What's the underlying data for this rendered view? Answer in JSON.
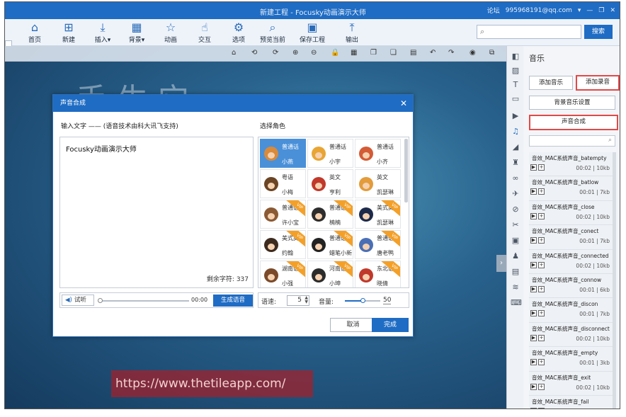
{
  "window": {
    "title": "新建工程 - Focusky动画演示大师",
    "forum": "论坛",
    "account": "995968191@qq.com"
  },
  "toolbar": {
    "items": [
      {
        "label": "首页",
        "icon": "home-icon"
      },
      {
        "label": "新建",
        "icon": "new-icon"
      },
      {
        "label": "插入▾",
        "icon": "insert-icon"
      },
      {
        "label": "背景▾",
        "icon": "background-icon"
      },
      {
        "label": "动画",
        "icon": "animation-icon"
      },
      {
        "label": "交互",
        "icon": "interaction-icon"
      },
      {
        "label": "选项",
        "icon": "gear-icon"
      },
      {
        "label": "预览当前",
        "icon": "preview-icon"
      },
      {
        "label": "保存工程",
        "icon": "save-icon"
      },
      {
        "label": "输出",
        "icon": "export-icon"
      }
    ],
    "search_button": "搜索"
  },
  "watermark": "https://www.thetileapp.com/",
  "right_panel": {
    "title": "音乐",
    "add_music": "添加音乐",
    "add_recording": "添加录音",
    "bg_music_settings": "背景音乐设置",
    "speech_synthesis": "声音合成",
    "sounds": [
      {
        "name": "音效_MAC系统声音_batempty",
        "time": "00:02",
        "size": "10kb"
      },
      {
        "name": "音效_MAC系统声音_batlow",
        "time": "00:01",
        "size": "7kb"
      },
      {
        "name": "音效_MAC系统声音_close",
        "time": "00:02",
        "size": "10kb"
      },
      {
        "name": "音效_MAC系统声音_conect",
        "time": "00:01",
        "size": "7kb"
      },
      {
        "name": "音效_MAC系统声音_connected",
        "time": "00:02",
        "size": "10kb"
      },
      {
        "name": "音效_MAC系统声音_connow",
        "time": "00:01",
        "size": "6kb"
      },
      {
        "name": "音效_MAC系统声音_discon",
        "time": "00:01",
        "size": "7kb"
      },
      {
        "name": "音效_MAC系统声音_disconnect",
        "time": "00:02",
        "size": "10kb"
      },
      {
        "name": "音效_MAC系统声音_empty",
        "time": "00:01",
        "size": "3kb"
      },
      {
        "name": "音效_MAC系统声音_exit",
        "time": "00:02",
        "size": "10kb"
      },
      {
        "name": "音效_MAC系统声音_fail",
        "time": "",
        "size": ""
      }
    ]
  },
  "dialog": {
    "title": "声音合成",
    "input_label": "输入文字 —— (语音技术由科大讯飞支持)",
    "input_value": "Focusky动画演示大师",
    "remaining": "剩余字符: 337",
    "listen": "试听",
    "time": "00:00",
    "generate": "生成语音",
    "role_label": "选择角色",
    "roles": [
      {
        "lang": "普通话",
        "name": "小燕",
        "vip": false,
        "selected": true,
        "color": "#d98a3a"
      },
      {
        "lang": "普通话",
        "name": "小宇",
        "vip": false,
        "selected": false,
        "color": "#e8a534"
      },
      {
        "lang": "普通话",
        "name": "小齐",
        "vip": false,
        "selected": false,
        "color": "#d35b36"
      },
      {
        "lang": "粤语",
        "name": "小梅",
        "vip": false,
        "selected": false,
        "color": "#6a4424"
      },
      {
        "lang": "英文",
        "name": "亨利",
        "vip": false,
        "selected": false,
        "color": "#c0392b"
      },
      {
        "lang": "英文",
        "name": "凯瑟琳",
        "vip": false,
        "selected": false,
        "color": "#e39b3b"
      },
      {
        "lang": "普通话",
        "name": "许小宝",
        "vip": true,
        "selected": false,
        "color": "#8a5a34"
      },
      {
        "lang": "普通话",
        "name": "楠楠",
        "vip": true,
        "selected": false,
        "color": "#2d2d2d"
      },
      {
        "lang": "美式英文",
        "name": "凯瑟琳",
        "vip": true,
        "selected": false,
        "color": "#1d2a4a"
      },
      {
        "lang": "美式英文",
        "name": "约翰",
        "vip": true,
        "selected": false,
        "color": "#3d2a1e"
      },
      {
        "lang": "普通话",
        "name": "蜡笔小新",
        "vip": true,
        "selected": false,
        "color": "#222222"
      },
      {
        "lang": "普通话",
        "name": "唐老鸭",
        "vip": true,
        "selected": false,
        "color": "#4a6fb5"
      },
      {
        "lang": "湖南话",
        "name": "小强",
        "vip": true,
        "selected": false,
        "color": "#7a4a2a"
      },
      {
        "lang": "河南话",
        "name": "小坤",
        "vip": true,
        "selected": false,
        "color": "#2b2b2b"
      },
      {
        "lang": "东北话",
        "name": "晓倩",
        "vip": true,
        "selected": false,
        "color": "#c0392b"
      }
    ],
    "vip_tag": "VIP",
    "speed_label": "语速:",
    "speed_value": "5",
    "volume_label": "音量:",
    "volume_value": "50",
    "volume_level": 0.5,
    "cancel": "取消",
    "ok": "完成"
  }
}
